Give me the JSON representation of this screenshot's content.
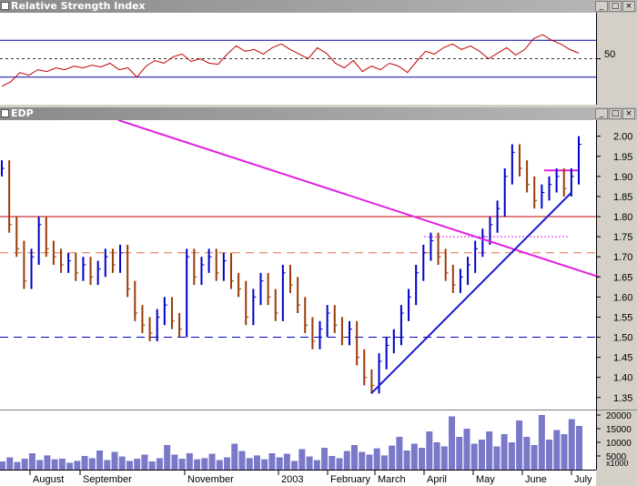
{
  "panels": {
    "rsi": {
      "title": "Relative Strength Index",
      "level_label": "50"
    },
    "price": {
      "title": "EDP"
    }
  },
  "window_buttons": {
    "minimize": "_",
    "maximize": "□",
    "close": "×"
  },
  "colors": {
    "price_up": "#0000c8",
    "price_down": "#9b3a0a",
    "rsi_line": "#c00000",
    "trend_magenta": "#e020e0",
    "trend_blue": "#1a1ad0",
    "resistance": "#c00000",
    "support_dash": "#0000c0",
    "volume": "#7a78c8"
  },
  "chart_data": [
    {
      "type": "line",
      "title": "Relative Strength Index",
      "ylim": [
        0,
        100
      ],
      "yticks": [
        50
      ],
      "reference_lines": [
        30,
        50,
        70
      ],
      "series": [
        {
          "values": [
            20,
            25,
            35,
            32,
            38,
            36,
            40,
            38,
            42,
            40,
            43,
            41,
            45,
            38,
            40,
            30,
            42,
            48,
            45,
            52,
            55,
            47,
            50,
            45,
            44,
            55,
            64,
            58,
            60,
            55,
            62,
            66,
            60,
            55,
            50,
            62,
            56,
            45,
            40,
            48,
            36,
            42,
            38,
            45,
            42,
            35,
            47,
            58,
            55,
            62,
            66,
            60,
            64,
            58,
            50,
            56,
            62,
            54,
            60,
            72,
            76,
            70,
            66,
            60,
            56
          ]
        }
      ]
    },
    {
      "type": "candlestick",
      "title": "EDP",
      "ylim": [
        1.32,
        2.04
      ],
      "yticks": [
        2.0,
        1.95,
        1.9,
        1.85,
        1.8,
        1.75,
        1.7,
        1.65,
        1.6,
        1.55,
        1.5,
        1.45,
        1.4,
        1.35
      ],
      "x_months": [
        "August",
        "September",
        "November",
        "2003",
        "February",
        "March",
        "April",
        "May",
        "June",
        "July"
      ],
      "close": [
        1.92,
        1.78,
        1.72,
        1.64,
        1.7,
        1.78,
        1.72,
        1.7,
        1.68,
        1.69,
        1.66,
        1.68,
        1.65,
        1.67,
        1.7,
        1.68,
        1.71,
        1.62,
        1.56,
        1.53,
        1.51,
        1.55,
        1.58,
        1.54,
        1.52,
        1.7,
        1.65,
        1.68,
        1.7,
        1.66,
        1.69,
        1.64,
        1.62,
        1.55,
        1.6,
        1.64,
        1.6,
        1.56,
        1.66,
        1.63,
        1.58,
        1.53,
        1.49,
        1.52,
        1.56,
        1.53,
        1.5,
        1.52,
        1.45,
        1.4,
        1.38,
        1.44,
        1.48,
        1.5,
        1.56,
        1.6,
        1.66,
        1.71,
        1.74,
        1.7,
        1.66,
        1.63,
        1.65,
        1.68,
        1.72,
        1.75,
        1.78,
        1.82,
        1.9,
        1.96,
        1.92,
        1.88,
        1.84,
        1.86,
        1.88,
        1.9,
        1.87,
        1.9,
        1.98
      ],
      "trendlines": [
        {
          "label": "descending",
          "from": [
            130,
            2.04
          ],
          "to": [
            658,
            1.65
          ]
        },
        {
          "label": "rising support",
          "from": [
            408,
            1.36
          ],
          "to": [
            628,
            1.86
          ]
        }
      ],
      "horizontal_lines": [
        {
          "value": 1.8,
          "style": "solid"
        },
        {
          "value": 1.71,
          "style": "dashed"
        },
        {
          "value": 1.5,
          "style": "dashed"
        },
        {
          "value": 1.75,
          "style": "dotted"
        },
        {
          "value": 1.915,
          "style": "solid"
        }
      ]
    },
    {
      "type": "bar",
      "title": "",
      "ylim": [
        0,
        22000
      ],
      "yticks": [
        20000,
        15000,
        10000,
        5000
      ],
      "unit_label": "x1000",
      "values": [
        3000,
        4500,
        2800,
        4000,
        6000,
        3500,
        5200,
        3800,
        4000,
        2500,
        3200,
        5000,
        4200,
        7000,
        3500,
        6500,
        4800,
        3200,
        4000,
        5500,
        3000,
        4200,
        9000,
        5500,
        4000,
        6000,
        3800,
        4200,
        5800,
        3500,
        4500,
        9500,
        6800,
        4200,
        5200,
        3800,
        6000,
        4500,
        5800,
        3200,
        7500,
        4800,
        3500,
        8000,
        5000,
        4200,
        6800,
        9000,
        6500,
        5500,
        7800,
        5200,
        8800,
        12000,
        7000,
        9500,
        8000,
        14000,
        10000,
        8500,
        19500,
        12000,
        15000,
        9500,
        11000,
        14000,
        8500,
        13000,
        10000,
        18000,
        12000,
        9000,
        20000,
        11000,
        14500,
        13000,
        18500,
        16000
      ]
    }
  ]
}
